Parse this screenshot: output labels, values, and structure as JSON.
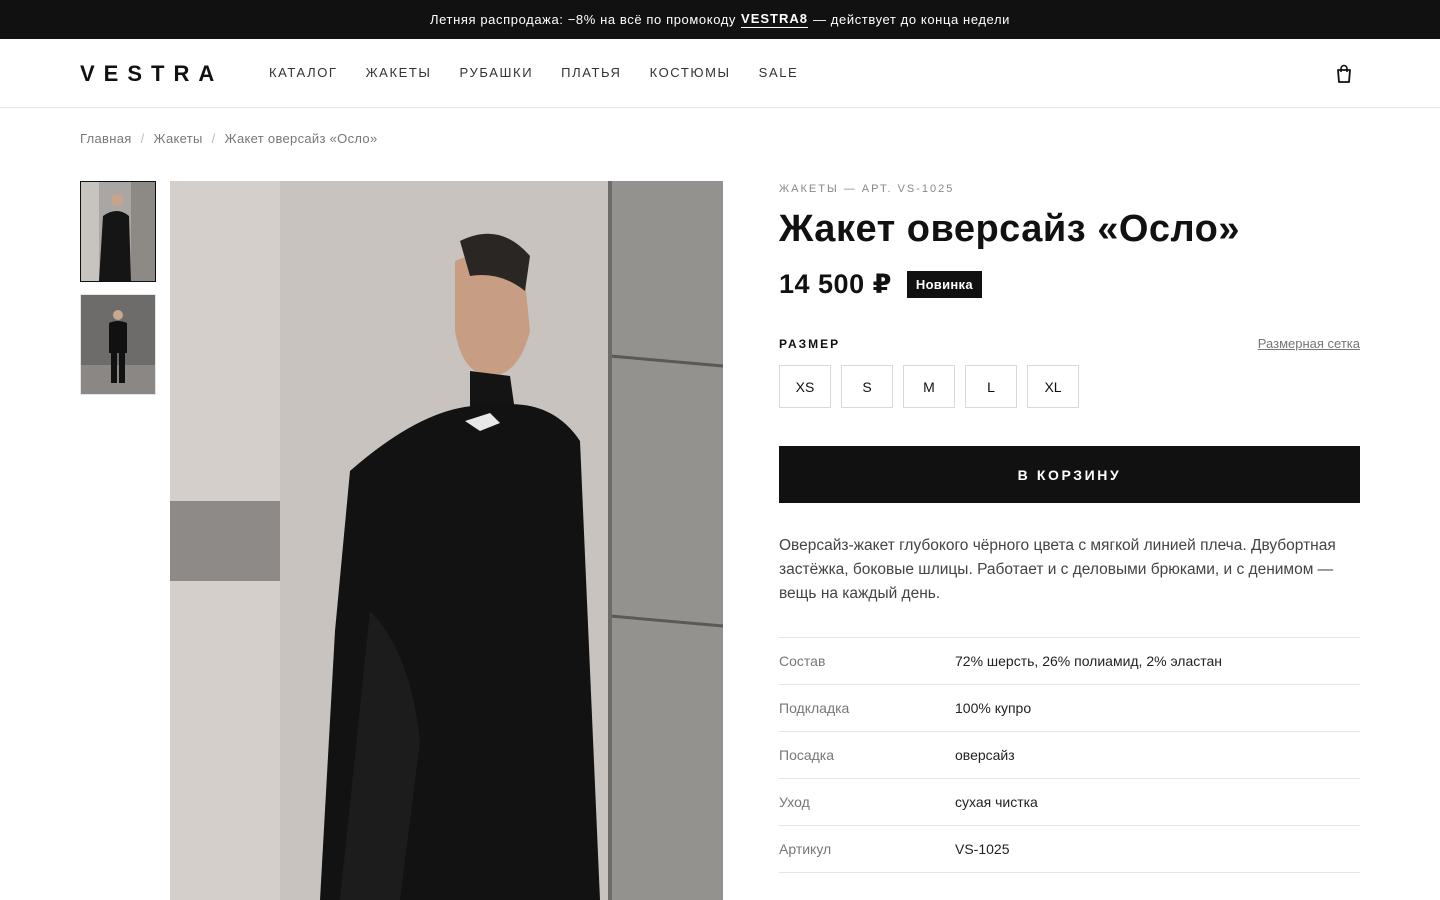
{
  "promo": {
    "text_before": "Летняя распродажа: −8% на всё по промокоду",
    "code": "VESTRA8",
    "text_after": "— действует до конца недели"
  },
  "header": {
    "logo": "VESTRA",
    "nav": [
      "КАТАЛОГ",
      "ЖАКЕТЫ",
      "РУБАШКИ",
      "ПЛАТЬЯ",
      "КОСТЮМЫ",
      "SALE"
    ],
    "cart_icon": "shopping-bag-icon"
  },
  "breadcrumb": [
    "Главная",
    "Жакеты",
    "Жакет оверсайз «Осло»"
  ],
  "gallery": {
    "thumbnails": [
      "photo-leaning-wall",
      "photo-full-length"
    ],
    "selected_index": 0
  },
  "product": {
    "meta": "ЖАКЕТЫ — АРТ. VS-1025",
    "title": "Жакет оверсайз «Осло»",
    "price": "14 500 ₽",
    "badge": "Новинка",
    "size_label": "РАЗМЕР",
    "size_guide": "Размерная сетка",
    "sizes": [
      "XS",
      "S",
      "M",
      "L",
      "XL"
    ],
    "add_to_cart": "В КОРЗИНУ",
    "description": "Оверсайз-жакет глубокого чёрного цвета с мягкой линией плеча. Двубортная застёжка, боковые шлицы. Работает и с деловыми брюками, и с денимом — вещь на каждый день.",
    "specs": [
      {
        "key": "Состав",
        "value": "72% шерсть, 26% полиамид, 2% эластан"
      },
      {
        "key": "Подкладка",
        "value": "100% купро"
      },
      {
        "key": "Посадка",
        "value": "оверсайз"
      },
      {
        "key": "Уход",
        "value": "сухая чистка"
      },
      {
        "key": "Артикул",
        "value": "VS-1025"
      }
    ]
  },
  "colors": {
    "primary": "#111111",
    "muted": "#777777",
    "border": "#e6e6e6"
  }
}
